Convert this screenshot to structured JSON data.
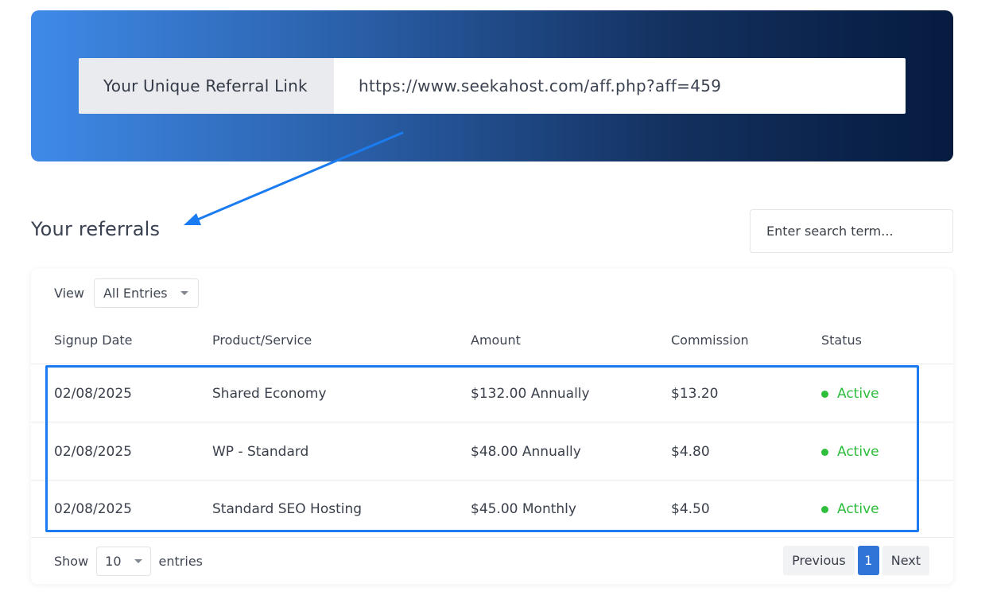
{
  "referral": {
    "label": "Your Unique Referral Link",
    "url": "https://www.seekahost.com/aff.php?aff=459"
  },
  "referrals": {
    "title": "Your referrals",
    "search_placeholder": "Enter search term..."
  },
  "filters": {
    "view_label": "View",
    "view_selected": "All Entries"
  },
  "table": {
    "headers": [
      "Signup Date",
      "Product/Service",
      "Amount",
      "Commission",
      "Status"
    ],
    "rows": [
      {
        "date": "02/08/2025",
        "product": "Shared Economy",
        "amount": "$132.00 Annually",
        "commission": "$13.20",
        "status": "Active"
      },
      {
        "date": "02/08/2025",
        "product": "WP - Standard",
        "amount": "$48.00 Annually",
        "commission": "$4.80",
        "status": "Active"
      },
      {
        "date": "02/08/2025",
        "product": "Standard SEO Hosting",
        "amount": "$45.00 Monthly",
        "commission": "$4.50",
        "status": "Active"
      }
    ]
  },
  "footer": {
    "show_label": "Show",
    "show_value": "10",
    "entries_label": "entries"
  },
  "pagination": {
    "previous": "Previous",
    "current": "1",
    "next": "Next"
  },
  "colors": {
    "annotation": "#1a7cf0",
    "status_active": "#2dbe3c",
    "page_active": "#2f74d6"
  }
}
